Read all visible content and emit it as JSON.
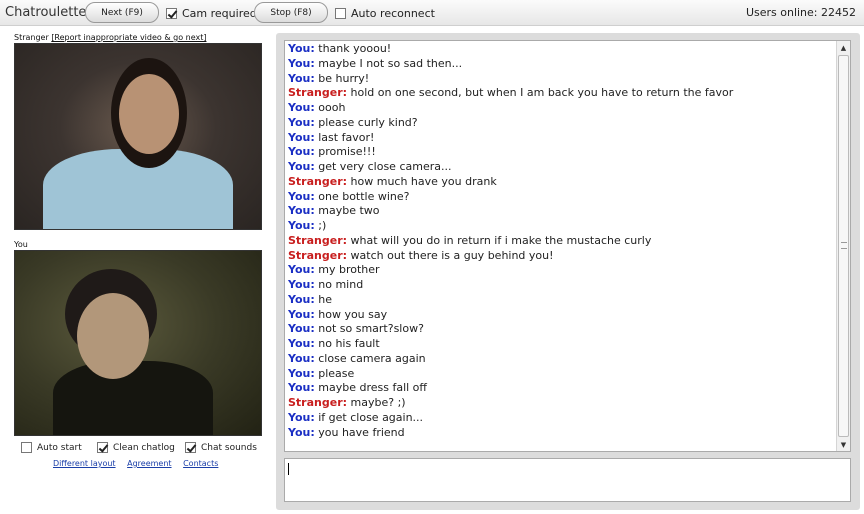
{
  "app": {
    "title": "Chatroulette"
  },
  "toolbar": {
    "next_label": "Next (F9)",
    "cam_required_label": "Cam required",
    "cam_required_checked": true,
    "stop_label": "Stop (F8)",
    "auto_reconnect_label": "Auto reconnect",
    "auto_reconnect_checked": false,
    "users_online": "Users online: 22452"
  },
  "stranger": {
    "label": "Stranger",
    "report_label": "[Report inappropriate video & go next]"
  },
  "you": {
    "label": "You"
  },
  "options": {
    "auto_start": {
      "label": "Auto start",
      "checked": false
    },
    "clean_chatlog": {
      "label": "Clean chatlog",
      "checked": true
    },
    "chat_sounds": {
      "label": "Chat sounds",
      "checked": true
    }
  },
  "links": {
    "different_layout": "Different layout",
    "agreement": "Agreement",
    "contacts": "Contacts"
  },
  "chat": {
    "messages": [
      {
        "who": "You:",
        "text": "thank yooou!"
      },
      {
        "who": "You:",
        "text": "maybe I not so sad then..."
      },
      {
        "who": "You:",
        "text": "be hurry!"
      },
      {
        "who": "Stranger:",
        "text": "hold on one second, but when I am back you have to return the favor"
      },
      {
        "who": "You:",
        "text": "oooh"
      },
      {
        "who": "You:",
        "text": "please curly kind?"
      },
      {
        "who": "You:",
        "text": "last favor!"
      },
      {
        "who": "You:",
        "text": "promise!!!"
      },
      {
        "who": "You:",
        "text": "get very close camera..."
      },
      {
        "who": "Stranger:",
        "text": "how much have you drank"
      },
      {
        "who": "You:",
        "text": "one bottle wine?"
      },
      {
        "who": "You:",
        "text": "maybe two"
      },
      {
        "who": "You:",
        "text": ";)"
      },
      {
        "who": "Stranger:",
        "text": "what will you do in return if i make the mustache curly"
      },
      {
        "who": "Stranger:",
        "text": "watch out there is a guy behind you!"
      },
      {
        "who": "You:",
        "text": "my brother"
      },
      {
        "who": "You:",
        "text": "no mind"
      },
      {
        "who": "You:",
        "text": "he"
      },
      {
        "who": "You:",
        "text": "how you say"
      },
      {
        "who": "You:",
        "text": "not so smart?slow?"
      },
      {
        "who": "You:",
        "text": "no his fault"
      },
      {
        "who": "You:",
        "text": "close camera again"
      },
      {
        "who": "You:",
        "text": "please"
      },
      {
        "who": "You:",
        "text": "maybe dress fall off"
      },
      {
        "who": "Stranger:",
        "text": "maybe? ;)"
      },
      {
        "who": "You:",
        "text": "if get close again..."
      },
      {
        "who": "You:",
        "text": "you have friend"
      }
    ],
    "input_value": ""
  },
  "colors": {
    "you": "#1a2ec4",
    "stranger": "#c81e1e"
  }
}
